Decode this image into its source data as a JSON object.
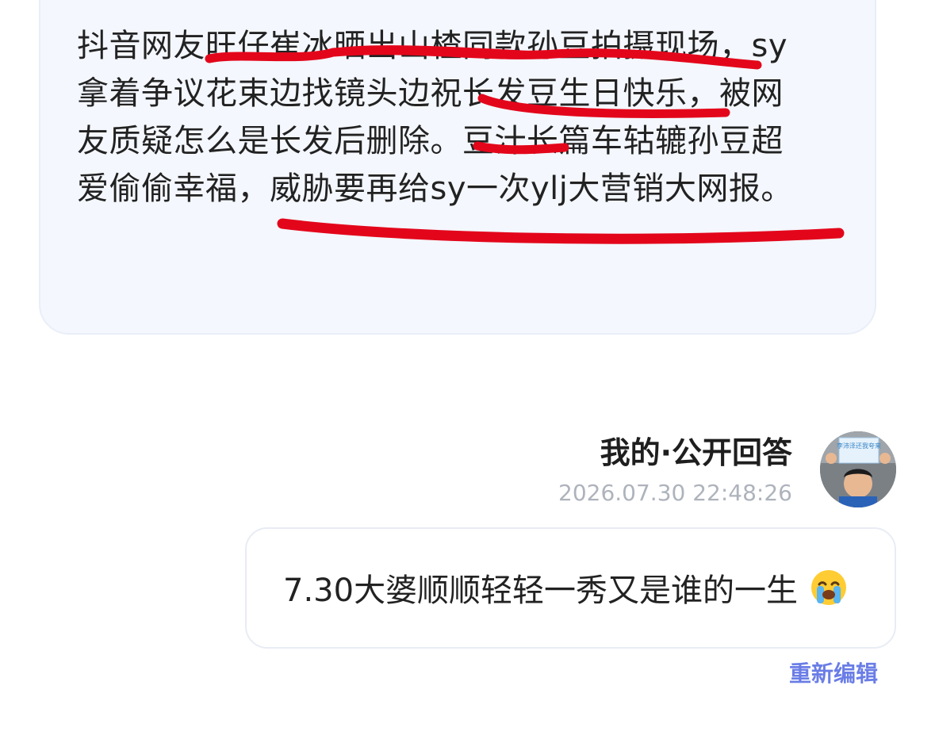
{
  "question": {
    "text": "抖音网友旺仔崔冰晒出山楂同款孙豆拍摄现场，sy拿着争议花束边找镜头边祝长发豆生日快乐，被网友质疑怎么是长发后删除。豆汁长篇车轱辘孙豆超爱偷偷幸福，威胁要再给sy一次ylj大营销大网报。"
  },
  "answer": {
    "title": "我的·公开回答",
    "timestamp": "2026.07.30 22:48:26",
    "text": "7.30大婆顺顺轻轻一秀又是谁的一生",
    "emoji_icon": "loudly-crying-face-icon"
  },
  "avatar": {
    "sign_text": "李沛泽还我夸来"
  },
  "actions": {
    "edit_label": "重新编辑"
  },
  "colors": {
    "card_bg": "#f4f7fd",
    "annotation_red": "#e3061b",
    "link_blue": "#6a7de6",
    "timestamp_gray": "#aeb3bc"
  }
}
